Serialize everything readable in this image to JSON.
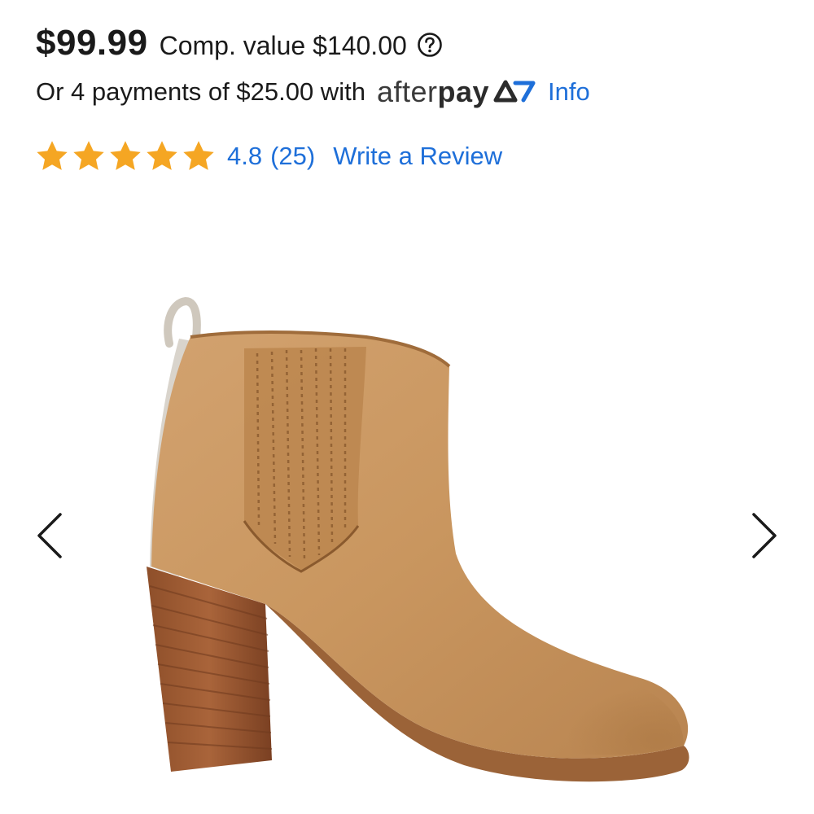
{
  "product": {
    "price": "$99.99",
    "comp_value": "Comp. value $140.00",
    "help_icon": "help-circle-icon"
  },
  "payments": {
    "text": "Or 4 payments of $25.00 with",
    "provider_light": "after",
    "provider_bold": "pay",
    "provider_icon": "afterpay-arrows-icon",
    "info_link": "Info"
  },
  "rating": {
    "stars": 5,
    "value": "4.8",
    "count": "(25)",
    "write_review": "Write a Review",
    "star_color": "#F5A623"
  },
  "gallery": {
    "image_name": "tan-suede-ankle-boot",
    "prev_icon": "chevron-left-icon",
    "next_icon": "chevron-right-icon"
  },
  "colors": {
    "link": "#1E6FD9",
    "text": "#1A1A1A"
  }
}
